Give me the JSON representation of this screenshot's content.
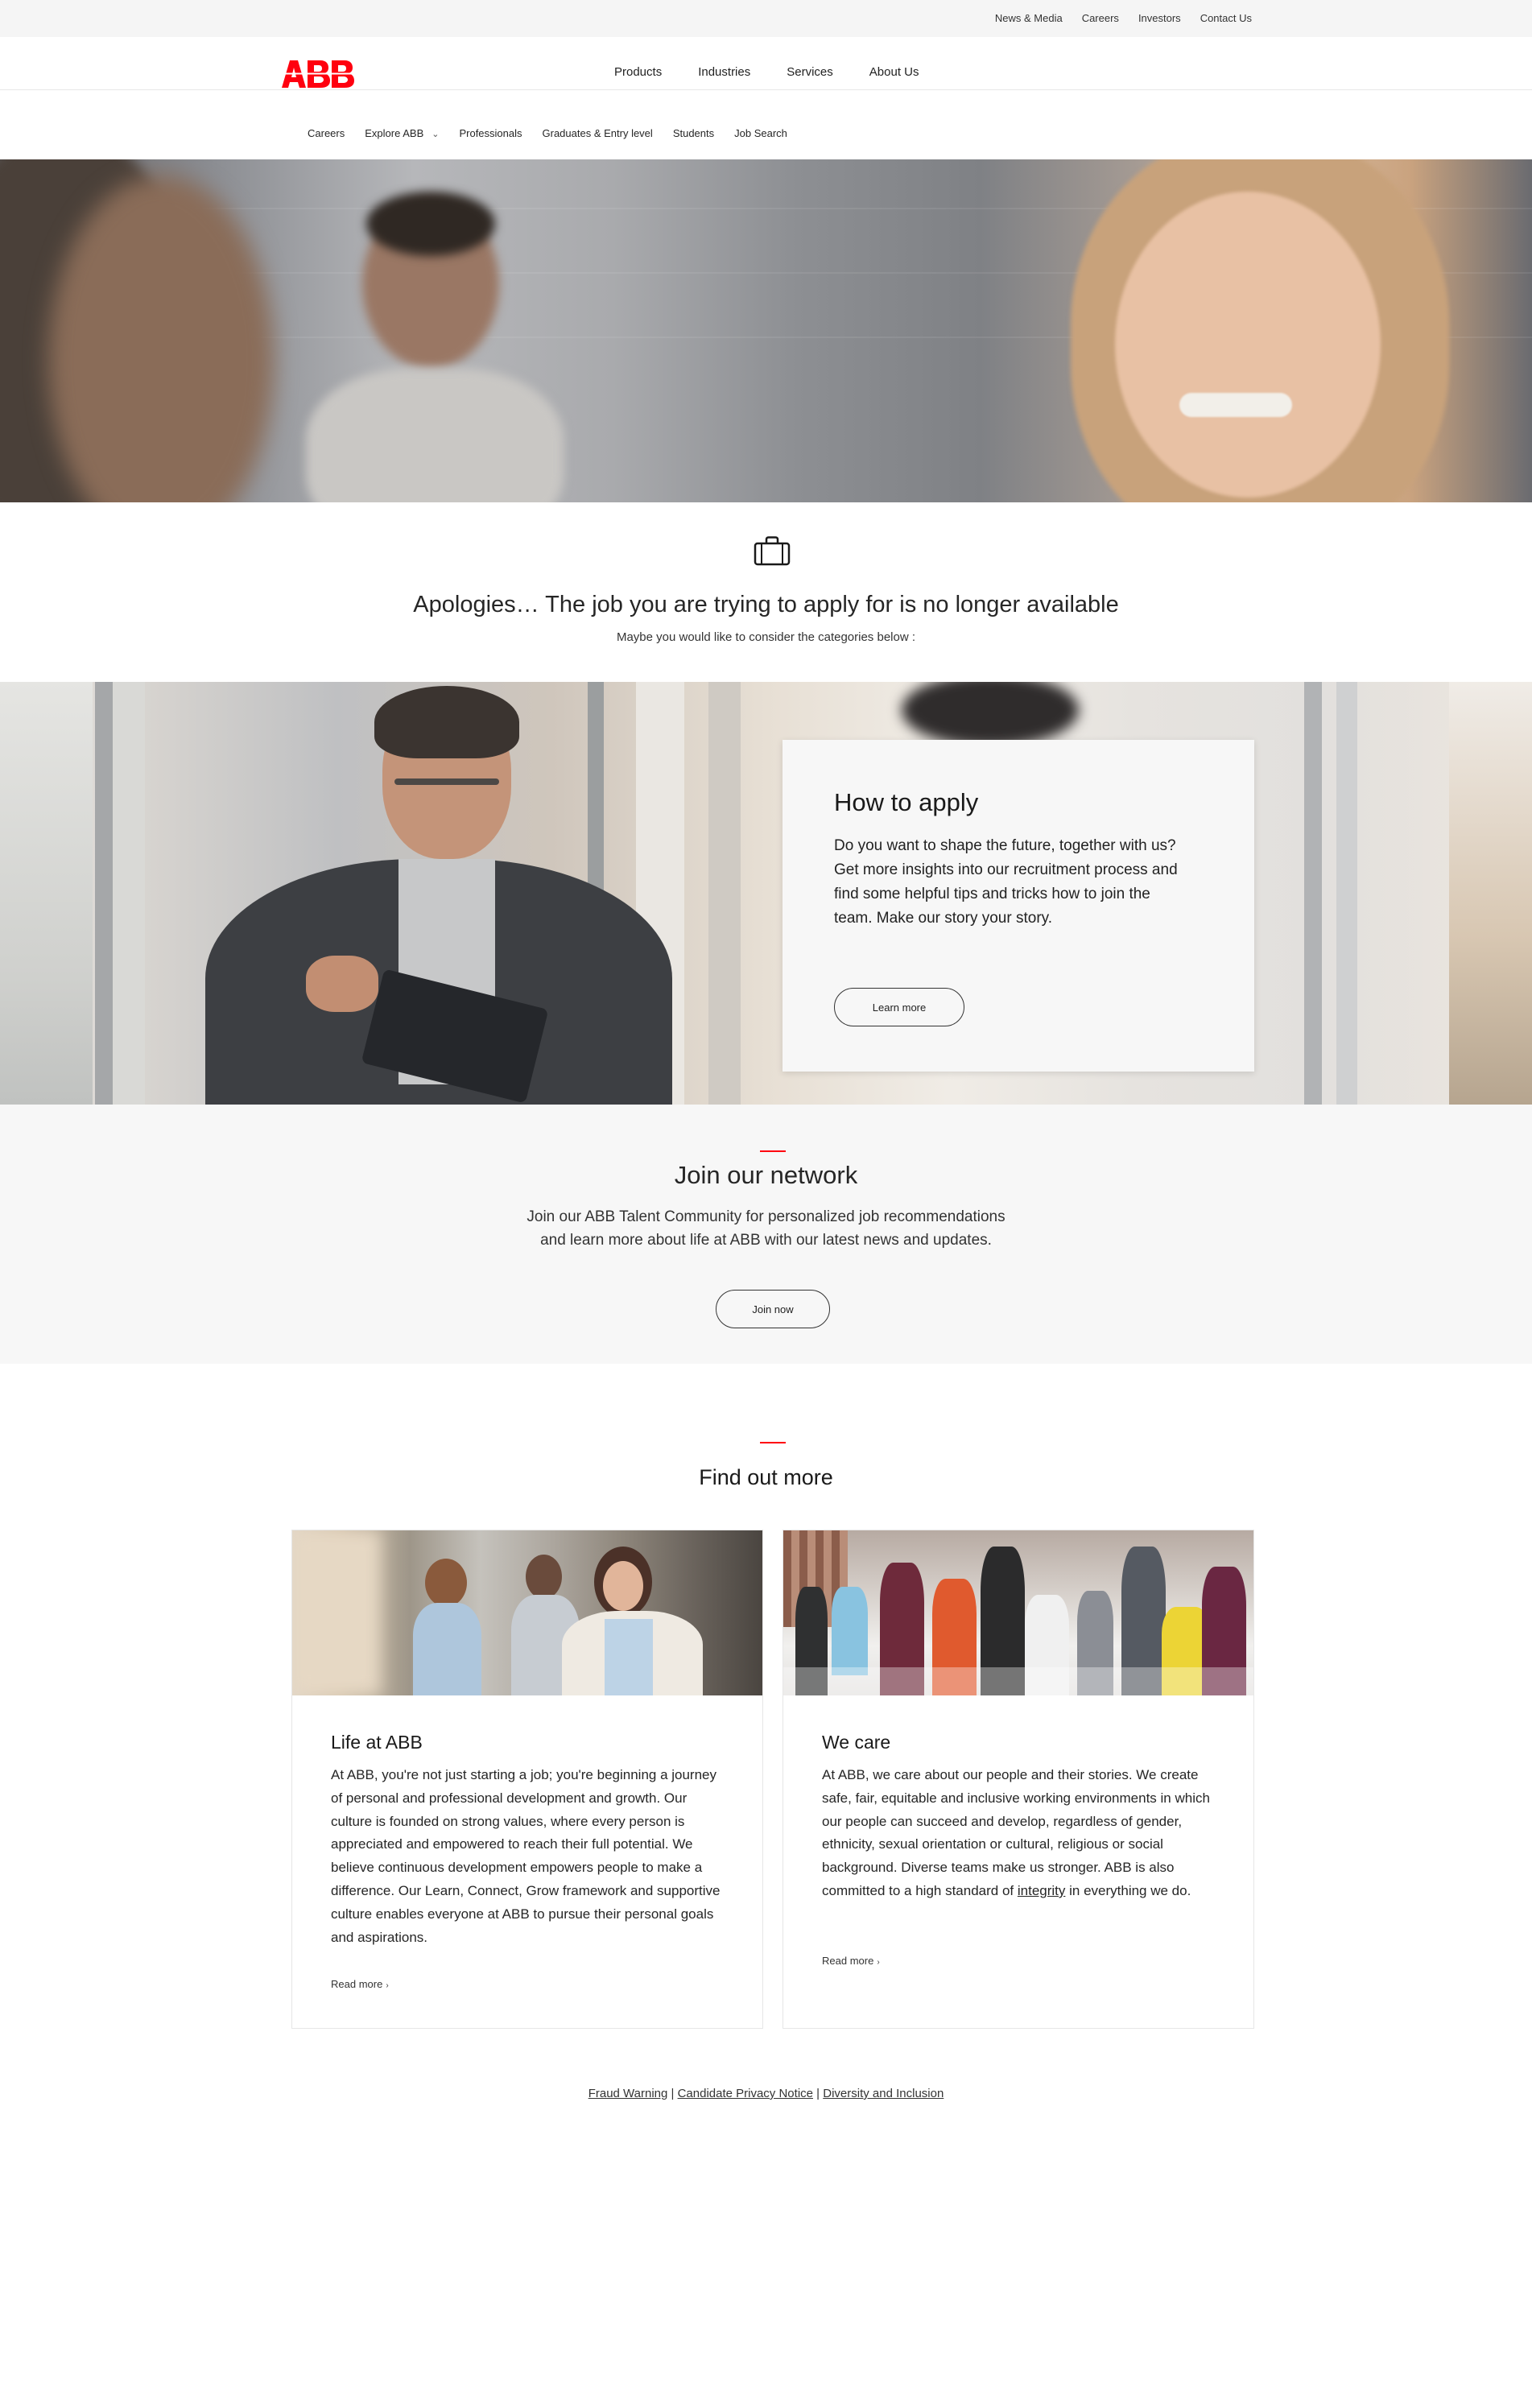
{
  "utility_nav": [
    "News & Media",
    "Careers",
    "Investors",
    "Contact Us"
  ],
  "brand": {
    "logo_text": "ABB",
    "color": "#FF000F"
  },
  "main_nav": [
    "Products",
    "Industries",
    "Services",
    "About Us"
  ],
  "sub_nav": {
    "items": [
      "Careers",
      "Explore ABB",
      "Professionals",
      "Graduates & Entry level",
      "Students",
      "Job Search"
    ],
    "explore_chevron": "⌄"
  },
  "apology": {
    "icon": "briefcase-icon",
    "title": "Apologies… The job you are trying to apply for is no longer available",
    "subtitle": "Maybe you would like to consider the categories below :"
  },
  "how_to_apply": {
    "title": "How to apply",
    "body": "Do you want to shape the future, together with us? Get more insights into our recruitment process and find some helpful tips and tricks how to join the team. Make our story your story.",
    "button": "Learn more"
  },
  "network": {
    "title": "Join our network",
    "line1": "Join our ABB Talent Community for personalized job recommendations",
    "line2": "and learn more about life at ABB with our latest news and updates.",
    "button": "Join now"
  },
  "find_out_more": {
    "title": "Find out more",
    "cards": [
      {
        "title": "Life at ABB",
        "body": "At ABB, you're not just starting a job; you're beginning a journey of personal and professional development and growth. Our culture is founded on strong values, where every person is appreciated and empowered to reach their full potential. We believe continuous development empowers people to make a difference. Our Learn, Connect, Grow framework and supportive culture enables everyone at ABB to pursue their personal goals and aspirations.",
        "link": "Read more"
      },
      {
        "title": "We care",
        "body_before": "At ABB, we care about our people and their stories. We create safe, fair, equitable and inclusive working environments in which our people can succeed and develop, regardless of gender, ethnicity, sexual orientation or cultural, religious or social background. Diverse teams make us stronger. ABB is also committed to a high standard of ",
        "body_link": "integrity",
        "body_after": " in everything we do.",
        "link": "Read more"
      }
    ]
  },
  "footer": {
    "links": [
      "Fraud Warning",
      "Candidate Privacy Notice",
      "Diversity and Inclusion"
    ],
    "separator": " | "
  }
}
